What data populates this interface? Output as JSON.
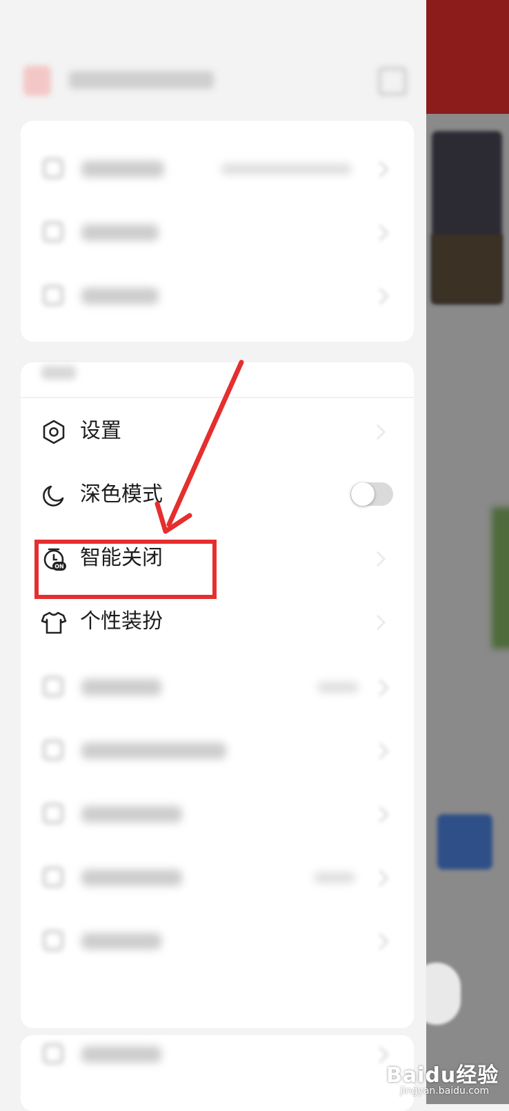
{
  "menu": {
    "settings": "设置",
    "dark_mode": "深色模式",
    "smart_close": "智能关闭",
    "personalize": "个性装扮"
  },
  "dark_mode_enabled": false,
  "highlight_color": "#e62e2e",
  "icons": {
    "settings": "hexagon-gear-icon",
    "dark_mode": "moon-icon",
    "smart_close": "timer-on-icon",
    "personalize": "tshirt-icon"
  },
  "smart_close_badge": "ON",
  "watermark": {
    "main": "Baidu经验",
    "sub": "jingyan.baidu.com"
  }
}
